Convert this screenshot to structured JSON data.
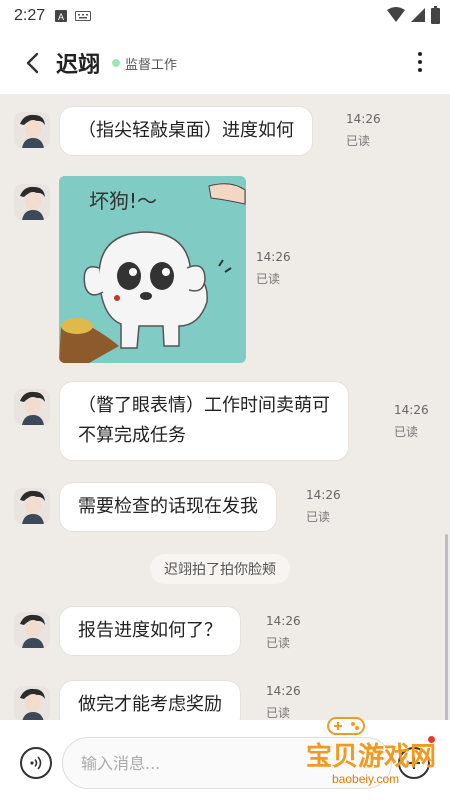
{
  "status_bar": {
    "time": "2:27"
  },
  "header": {
    "title": "迟翊",
    "status": "监督工作"
  },
  "messages": [
    {
      "text": "（指尖轻敲桌面）进度如何",
      "time": "14:26",
      "read": "已读"
    },
    {
      "time": "14:26",
      "read": "已读",
      "sticker_text": "坏狗!～"
    },
    {
      "line1": "（瞥了眼表情）工作时间卖萌可",
      "line2": "不算完成任务",
      "time": "14:26",
      "read": "已读"
    },
    {
      "text": "需要检查的话现在发我",
      "time": "14:26",
      "read": "已读"
    },
    {
      "text": "报告进度如何了？",
      "time": "14:26",
      "read": "已读"
    },
    {
      "text": "做完才能考虑奖励",
      "time": "14:26",
      "read": "已读"
    }
  ],
  "system_note": "迟翊拍了拍你脸颊",
  "input": {
    "placeholder": "输入消息..."
  },
  "watermark": {
    "text": "宝贝游戏网",
    "url": "baobeiy.com"
  },
  "colors": {
    "background": "#efebe7",
    "online_dot": "#9fe3b8",
    "sticker_bg": "#80cbc4",
    "watermark": "#f29a1f"
  },
  "icons": [
    "android-icon",
    "keyboard-icon",
    "wifi-icon",
    "battery-icon",
    "back-icon",
    "more-icon",
    "voice-icon",
    "plus-icon"
  ]
}
